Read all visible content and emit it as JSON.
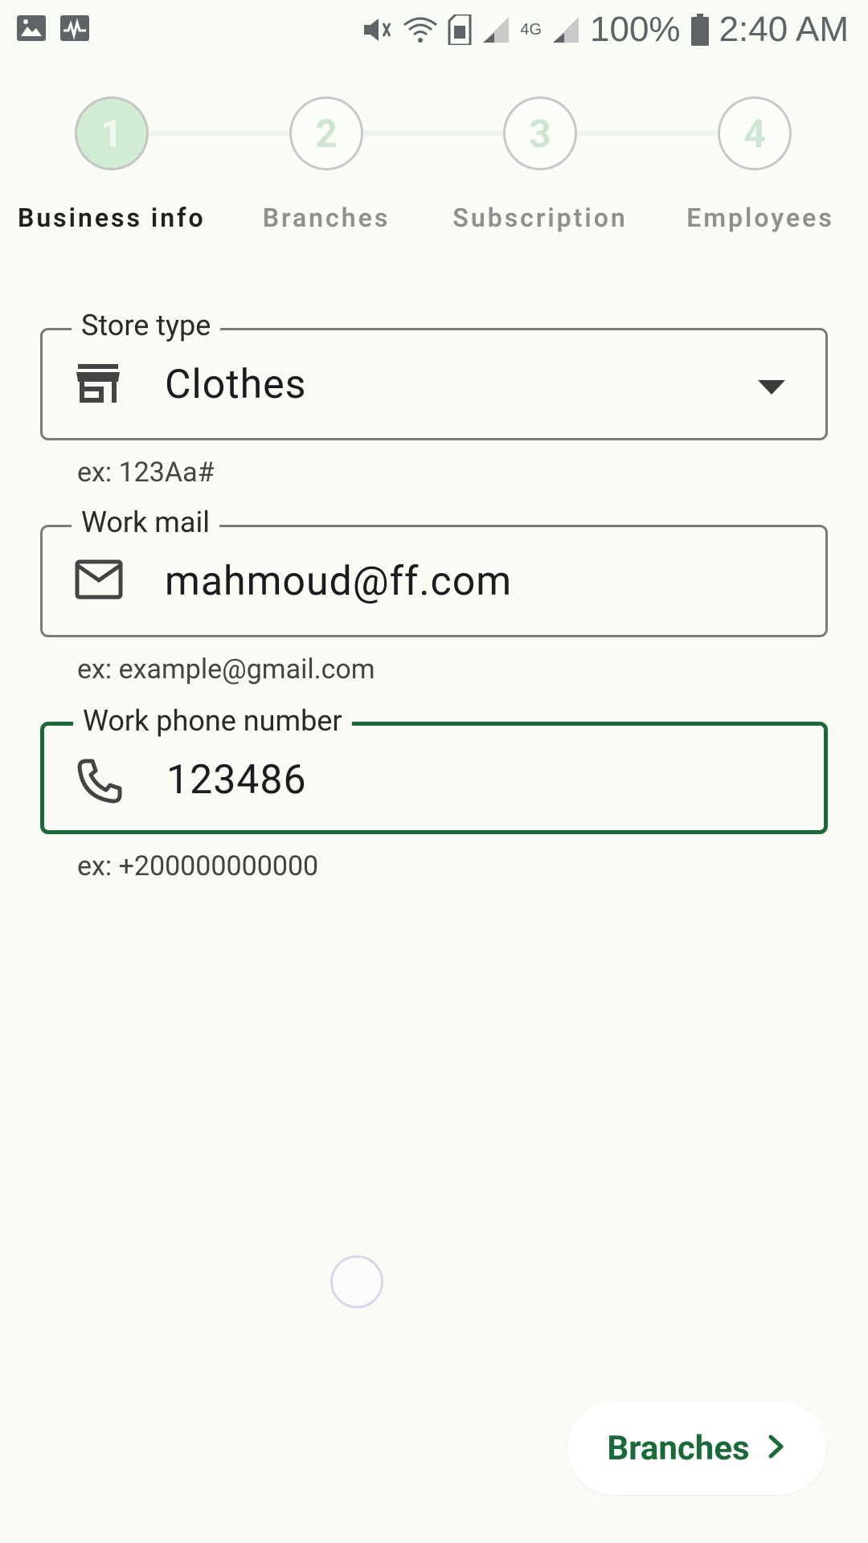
{
  "status_bar": {
    "battery": "100%",
    "time": "2:40 AM",
    "network": "4G"
  },
  "stepper": {
    "steps": [
      {
        "number": "1",
        "label": "Business info",
        "active": true
      },
      {
        "number": "2",
        "label": "Branches",
        "active": false
      },
      {
        "number": "3",
        "label": "Subscription",
        "active": false
      },
      {
        "number": "4",
        "label": "Employees",
        "active": false
      }
    ]
  },
  "form": {
    "store_type": {
      "label": "Store type",
      "value": "Clothes",
      "helper": "ex: 123Aa#",
      "icon": "store-icon"
    },
    "work_mail": {
      "label": "Work mail",
      "value": "mahmoud@ff.com",
      "helper": "ex: example@gmail.com",
      "icon": "mail-icon"
    },
    "work_phone": {
      "label": "Work phone number",
      "value": "123486",
      "helper": "ex: +200000000000",
      "icon": "phone-icon"
    }
  },
  "next_button": {
    "label": "Branches",
    "icon": "chevron-right-icon"
  },
  "colors": {
    "accent": "#1b6b3a",
    "background": "#f8fcf5",
    "step_active": "#d2ebd3"
  }
}
